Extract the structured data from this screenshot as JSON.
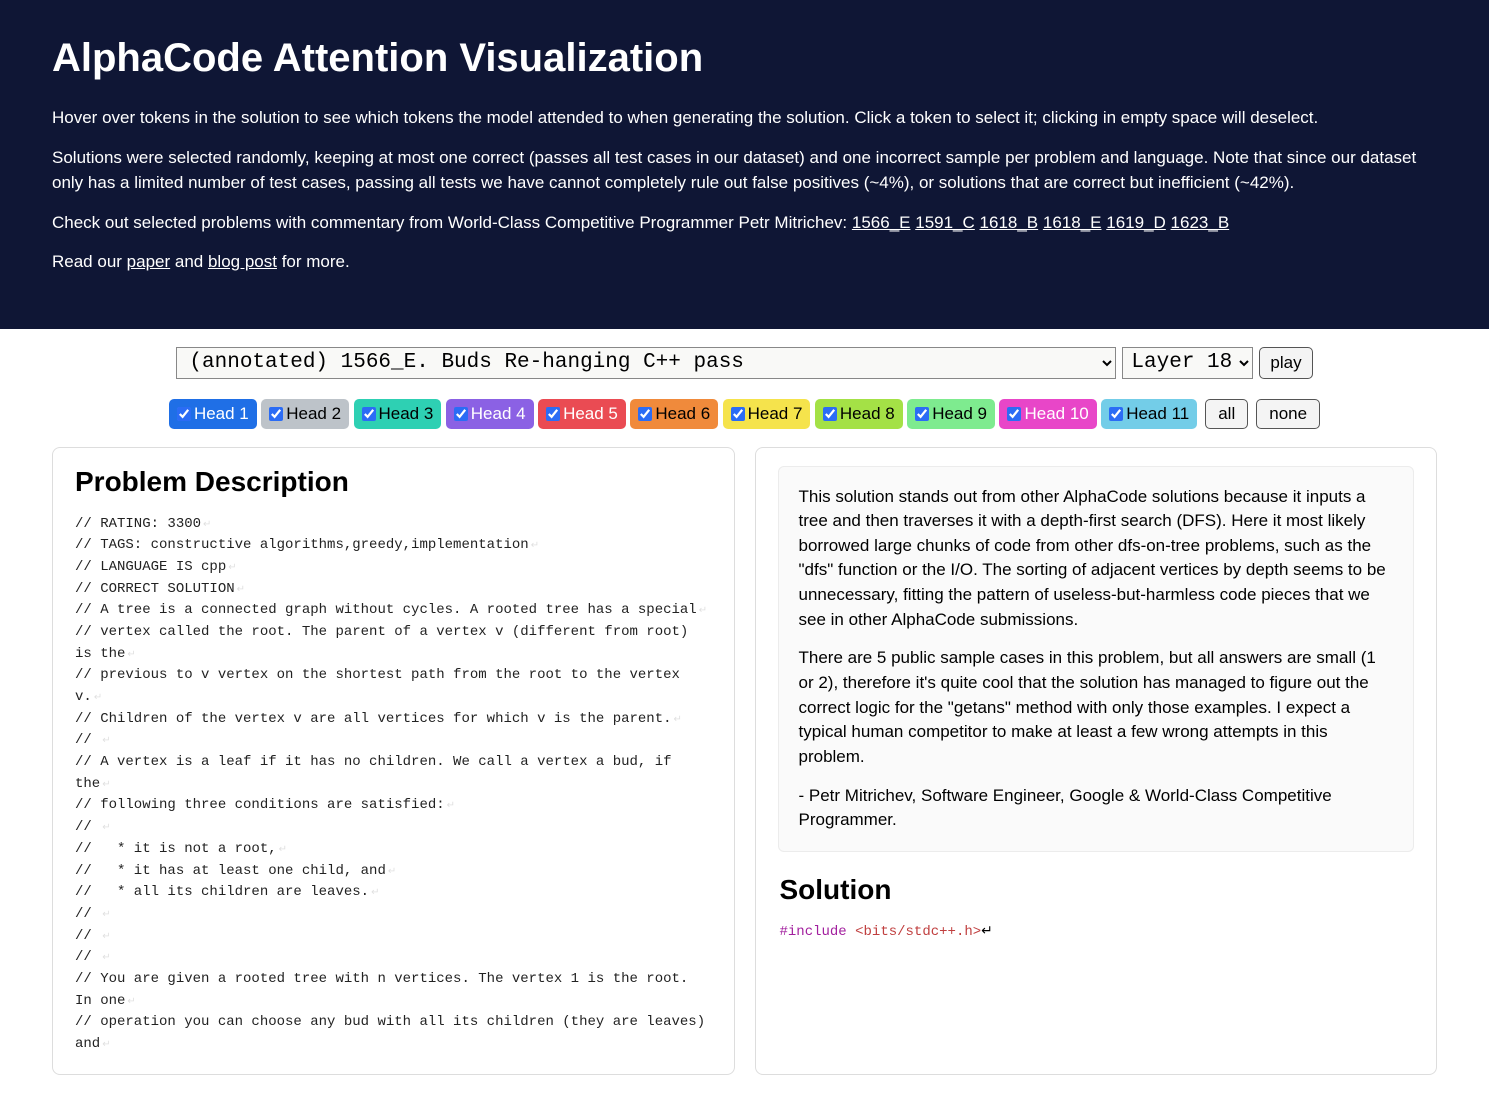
{
  "header": {
    "title": "AlphaCode Attention Visualization",
    "p1": "Hover over tokens in the solution to see which tokens the model attended to when generating the solution. Click a token to select it; clicking in empty space will deselect.",
    "p2": "Solutions were selected randomly, keeping at most one correct (passes all test cases in our dataset) and one incorrect sample per problem and language. Note that since our dataset only has a limited number of test cases, passing all tests we have cannot completely rule out false positives (~4%), or solutions that are correct but inefficient (~42%).",
    "p3_prefix": "Check out selected problems with commentary from World-Class Competitive Programmer Petr Mitrichev: ",
    "commentary_links": [
      "1566_E",
      "1591_C",
      "1618_B",
      "1618_E",
      "1619_D",
      "1623_B"
    ],
    "p4_prefix": "Read our ",
    "p4_link1": "paper",
    "p4_mid": " and ",
    "p4_link2": "blog post",
    "p4_suffix": " for more."
  },
  "controls": {
    "problem_option": "(annotated) 1566_E. Buds Re-hanging             C++          pass",
    "layer_option": "Layer 18",
    "play_label": "play"
  },
  "heads": [
    {
      "label": "Head 1",
      "bg": "#1f6fe6",
      "fg": "#ffffff"
    },
    {
      "label": "Head 2",
      "bg": "#bdc3c9",
      "fg": "#000000"
    },
    {
      "label": "Head 3",
      "bg": "#2ed0b3",
      "fg": "#000000"
    },
    {
      "label": "Head 4",
      "bg": "#8b61e4",
      "fg": "#ffffff"
    },
    {
      "label": "Head 5",
      "bg": "#ea4b53",
      "fg": "#ffffff"
    },
    {
      "label": "Head 6",
      "bg": "#f08a3b",
      "fg": "#000000"
    },
    {
      "label": "Head 7",
      "bg": "#f5e34c",
      "fg": "#000000"
    },
    {
      "label": "Head 8",
      "bg": "#a4e146",
      "fg": "#000000"
    },
    {
      "label": "Head 9",
      "bg": "#7eeb8f",
      "fg": "#000000"
    },
    {
      "label": "Head 10",
      "bg": "#e846c8",
      "fg": "#ffffff"
    },
    {
      "label": "Head 11",
      "bg": "#73cde8",
      "fg": "#000000"
    }
  ],
  "head_controls": {
    "all": "all",
    "none": "none"
  },
  "left_panel": {
    "heading": "Problem Description",
    "code_lines": [
      "// RATING: 3300",
      "// TAGS: constructive algorithms,greedy,implementation",
      "// LANGUAGE IS cpp",
      "// CORRECT SOLUTION",
      "// A tree is a connected graph without cycles. A rooted tree has a special",
      "// vertex called the root. The parent of a vertex v (different from root) is the",
      "// previous to v vertex on the shortest path from the root to the vertex v.",
      "// Children of the vertex v are all vertices for which v is the parent.",
      "// ",
      "// A vertex is a leaf if it has no children. We call a vertex a bud, if the",
      "// following three conditions are satisfied:",
      "// ",
      "//   * it is not a root,",
      "//   * it has at least one child, and",
      "//   * all its children are leaves.",
      "// ",
      "// ",
      "// ",
      "// You are given a rooted tree with n vertices. The vertex 1 is the root. In one",
      "// operation you can choose any bud with all its children (they are leaves) and"
    ]
  },
  "right_panel": {
    "commentary_p1": "This solution stands out from other AlphaCode solutions because it inputs a tree and then traverses it with a depth-first search (DFS). Here it most likely borrowed large chunks of code from other dfs-on-tree problems, such as the \"dfs\" function or the I/O. The sorting of adjacent vertices by depth seems to be unnecessary, fitting the pattern of useless-but-harmless code pieces that we see in other AlphaCode submissions.",
    "commentary_p2": "There are 5 public sample cases in this problem, but all answers are small (1 or 2), therefore it's quite cool that the solution has managed to figure out the correct logic for the \"getans\" method with only those examples. I expect a typical human competitor to make at least a few wrong attempts in this problem.",
    "commentary_p3": "- Petr Mitrichev, Software Engineer, Google & World-Class Competitive Programmer.",
    "solution_heading": "Solution",
    "solution_include_directive": "#include",
    "solution_include_header": "<bits/stdc++.h>"
  }
}
